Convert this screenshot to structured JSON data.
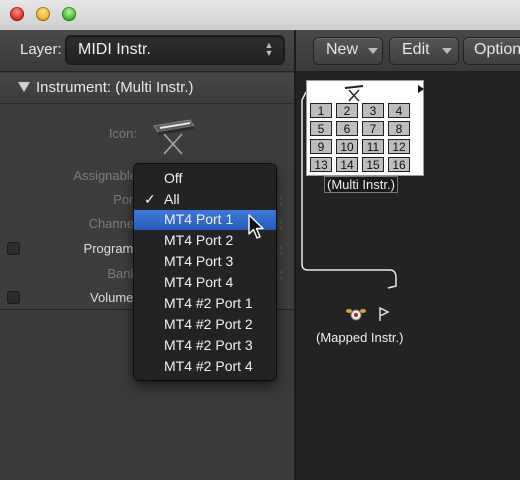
{
  "layer": {
    "label": "Layer:",
    "value": "MIDI Instr."
  },
  "instrument_header": "Instrument: (Multi Instr.)",
  "inspector": {
    "icon_label": "Icon:",
    "assignable_label": "Assignable",
    "port_label": "Port",
    "channel_label": "Channel",
    "program_label": "Program:",
    "bank_label": "Bank",
    "volume_label": "Volume:"
  },
  "toolbar": {
    "new_label": "New",
    "edit_label": "Edit",
    "options_label": "Option"
  },
  "multi_instrument": {
    "cells": [
      "1",
      "2",
      "3",
      "4",
      "5",
      "6",
      "7",
      "8",
      "9",
      "10",
      "11",
      "12",
      "13",
      "14",
      "15",
      "16"
    ],
    "label": "(Multi Instr.)"
  },
  "mapped_instrument": {
    "label": "(Mapped Instr.)"
  },
  "port_menu": {
    "checked": "All",
    "highlighted": "MT4 Port 1",
    "items": [
      "Off",
      "All",
      "MT4 Port 1",
      "MT4 Port 2",
      "MT4 Port 3",
      "MT4 Port 4",
      "MT4 #2 Port 1",
      "MT4 #2 Port 2",
      "MT4 #2 Port 3",
      "MT4 #2 Port 4"
    ]
  },
  "colors": {
    "highlight": "#2f68cc",
    "panel": "#3a3a3a",
    "canvas": "#232323"
  }
}
